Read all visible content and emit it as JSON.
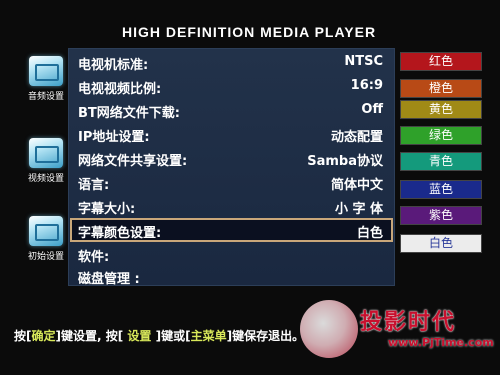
{
  "header": {
    "title": "HIGH DEFINITION MEDIA PLAYER"
  },
  "sidebar": {
    "items": [
      {
        "label": "音频设置",
        "icon": "audio-folder-icon"
      },
      {
        "label": "视频设置",
        "icon": "video-folder-icon"
      },
      {
        "label": "初始设置",
        "icon": "settings-folder-icon"
      }
    ]
  },
  "menu": {
    "rows": [
      {
        "label": "电视机标准:",
        "value": "NTSC"
      },
      {
        "label": "电视视频比例:",
        "value": "16:9"
      },
      {
        "label": "BT网络文件下载:",
        "value": "Off"
      },
      {
        "label": "IP地址设置:",
        "value": "动态配置"
      },
      {
        "label": "网络文件共享设置:",
        "value": "Samba协议"
      },
      {
        "label": "语言:",
        "value": "简体中文"
      },
      {
        "label": "字幕大小:",
        "value": "小 字 体"
      },
      {
        "label": "字幕颜色设置:",
        "value": "白色"
      },
      {
        "label": "软件:",
        "value": ""
      },
      {
        "label": "磁盘管理 :",
        "value": ""
      }
    ],
    "selected_index": 7
  },
  "colors": {
    "options": [
      {
        "label": "红色",
        "bg": "#b4161c",
        "fg": "#ffffff"
      },
      {
        "label": "橙色",
        "bg": "#b84a16",
        "fg": "#ffffff"
      },
      {
        "label": "黄色",
        "bg": "#a08a16",
        "fg": "#ffffff"
      },
      {
        "label": "绿色",
        "bg": "#2fa12a",
        "fg": "#ffffff"
      },
      {
        "label": "青色",
        "bg": "#149a7c",
        "fg": "#ffffff"
      },
      {
        "label": "蓝色",
        "bg": "#1a2a8c",
        "fg": "#ffffff"
      },
      {
        "label": "紫色",
        "bg": "#5a1a7a",
        "fg": "#ffffff"
      },
      {
        "label": "白色",
        "bg": "#ececec",
        "fg": "#2a3a9a"
      }
    ]
  },
  "hint": {
    "p1": "按[",
    "k1": "确定",
    "p2": "]键设置, 按[",
    "k2": " 设置 ",
    "p3": "]键或[",
    "k3": "主菜单",
    "p4": "]键保存退出。"
  },
  "watermark": {
    "text": "投影时代",
    "url": "www.PjTime.com"
  }
}
